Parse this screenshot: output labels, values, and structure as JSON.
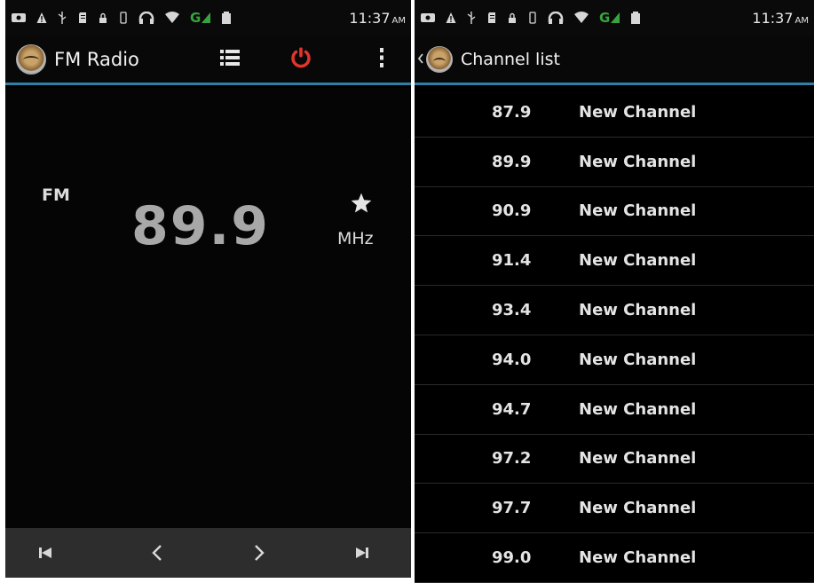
{
  "status_bar": {
    "time": "11:37",
    "ampm": "AM",
    "network_type": "G",
    "icons": [
      "notification-icon",
      "warning-icon",
      "usb-icon",
      "sd-card-icon",
      "lock-icon",
      "vibrate-icon",
      "headphones-icon",
      "wifi-icon",
      "signal-icon",
      "battery-icon"
    ]
  },
  "radio_screen": {
    "title": "FM Radio",
    "app_icon": "radio-dial-icon",
    "actions": [
      "channel-list-icon",
      "power-icon",
      "overflow-menu-icon"
    ],
    "band": "FM",
    "frequency": "89.9",
    "unit": "MHz",
    "favorite_icon": "star-icon",
    "controls": [
      "skip-previous-icon",
      "seek-back-icon",
      "seek-forward-icon",
      "skip-next-icon"
    ]
  },
  "channel_list_screen": {
    "title": "Channel list",
    "back_icon": "back-chevron-icon",
    "channels": [
      {
        "freq": "87.9",
        "name": "New Channel"
      },
      {
        "freq": "89.9",
        "name": "New Channel"
      },
      {
        "freq": "90.9",
        "name": "New Channel"
      },
      {
        "freq": "91.4",
        "name": "New Channel"
      },
      {
        "freq": "93.4",
        "name": "New Channel"
      },
      {
        "freq": "94.0",
        "name": "New Channel"
      },
      {
        "freq": "94.7",
        "name": "New Channel"
      },
      {
        "freq": "97.2",
        "name": "New Channel"
      },
      {
        "freq": "97.7",
        "name": "New Channel"
      },
      {
        "freq": "99.0",
        "name": "New Channel"
      }
    ]
  },
  "colors": {
    "accent_line": "#2f7fa6",
    "power_red": "#e0352b",
    "signal_green": "#38a33e",
    "control_bar": "#2d2d2d"
  }
}
